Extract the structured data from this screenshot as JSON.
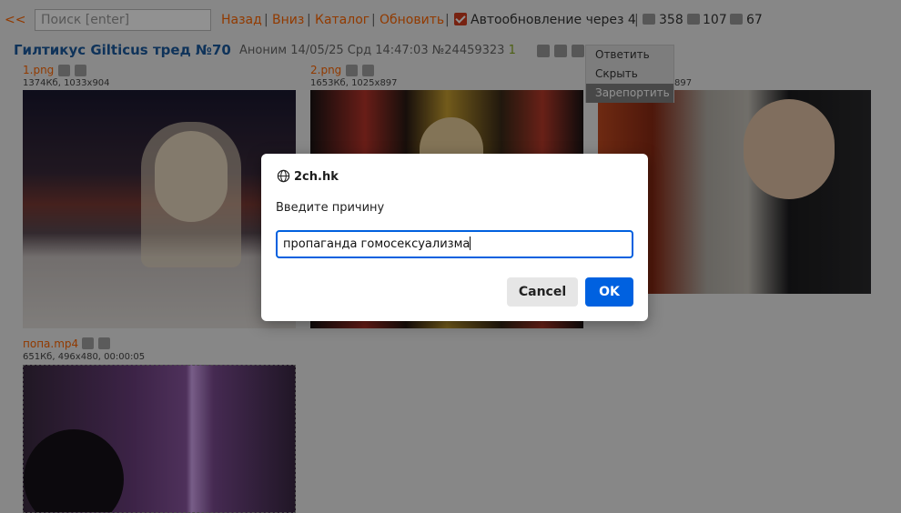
{
  "nav": {
    "back_arrows": "<<",
    "search_placeholder": "Поиск [enter]",
    "back": "Назад",
    "down": "Вниз",
    "catalog": "Каталог",
    "refresh": "Обновить",
    "autorefresh": "Автообновление через 4",
    "separator": "|",
    "posts_count": "358",
    "images_count": "107",
    "users_count": "67"
  },
  "thread": {
    "title": "Гилтикус Gilticus тред №70",
    "author": "Аноним",
    "datetime": "14/05/25 Срд 14:47:03",
    "post_number": "№24459323",
    "reply_count": "1"
  },
  "files": [
    {
      "name": "1.png",
      "info": "1374Кб, 1033x904"
    },
    {
      "name": "2.png",
      "info": "1653Кб, 1025x897"
    },
    {
      "name": "",
      "info": "897"
    },
    {
      "name": "попа.mp4",
      "info": "651Кб, 496x480, 00:00:05"
    }
  ],
  "context_menu": {
    "items": [
      "Ответить",
      "Скрыть",
      "Зарепортить"
    ],
    "selected_index": 2
  },
  "dialog": {
    "host": "2ch.hk",
    "prompt": "Введите причину",
    "input_value": "пропаганда гомосексуализма",
    "cancel_label": "Cancel",
    "ok_label": "OK",
    "accent_color": "#0061e0"
  },
  "colors": {
    "link": "#ff6600",
    "title": "#1b5a9f",
    "background": "#eeeeee"
  }
}
